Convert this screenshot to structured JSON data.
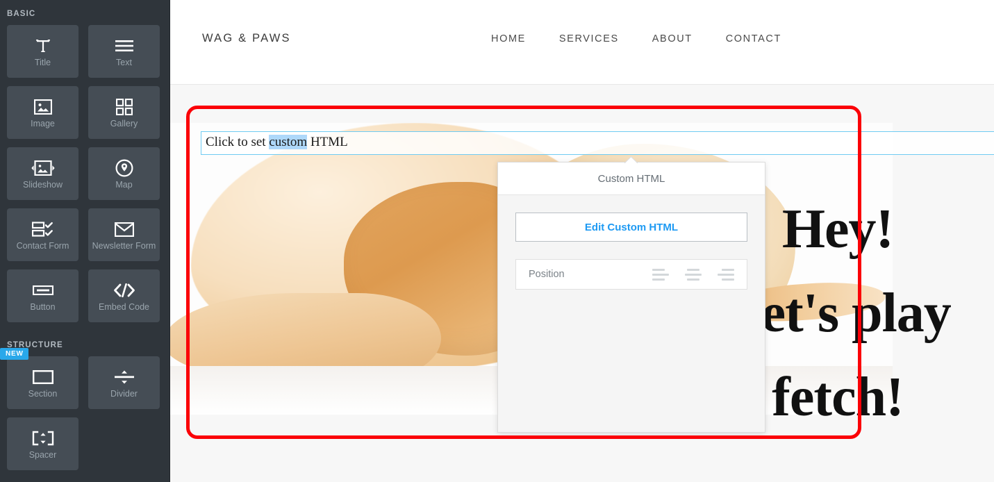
{
  "sidebar": {
    "sections": [
      {
        "label": "BASIC",
        "items": [
          {
            "label": "Title",
            "icon": "title-icon"
          },
          {
            "label": "Text",
            "icon": "text-lines-icon"
          },
          {
            "label": "Image",
            "icon": "image-icon"
          },
          {
            "label": "Gallery",
            "icon": "gallery-grid-icon"
          },
          {
            "label": "Slideshow",
            "icon": "slideshow-icon"
          },
          {
            "label": "Map",
            "icon": "map-pin-icon"
          },
          {
            "label": "Contact Form",
            "icon": "contact-form-icon"
          },
          {
            "label": "Newsletter Form",
            "icon": "envelope-icon"
          },
          {
            "label": "Button",
            "icon": "button-icon"
          },
          {
            "label": "Embed Code",
            "icon": "code-brackets-icon"
          }
        ]
      },
      {
        "label": "STRUCTURE",
        "items": [
          {
            "label": "Section",
            "icon": "rectangle-icon",
            "badge": "NEW"
          },
          {
            "label": "Divider",
            "icon": "divider-icon"
          },
          {
            "label": "Spacer",
            "icon": "spacer-icon"
          }
        ]
      }
    ]
  },
  "site": {
    "logo": "WAG & PAWS",
    "nav": [
      {
        "label": "HOME"
      },
      {
        "label": "SERVICES"
      },
      {
        "label": "ABOUT"
      },
      {
        "label": "CONTACT"
      }
    ],
    "hero": {
      "line1": "Hey!",
      "line2": "Let's play",
      "line3": "fetch!",
      "image_alt": "golden-retriever-puppy-lying-down"
    }
  },
  "custom_html_element": {
    "text_before": "Click to set ",
    "text_selected": "custom",
    "text_after": " HTML"
  },
  "popup": {
    "title": "Custom HTML",
    "edit_button_label": "Edit Custom HTML",
    "position_label": "Position",
    "alignment_options": [
      "align-left",
      "align-center",
      "align-right"
    ]
  },
  "colors": {
    "sidebar_bg": "#2f353b",
    "tile_bg": "#454d55",
    "badge_blue": "#29a8ea",
    "link_blue": "#1e9af3",
    "selection_blue": "#aed8fa",
    "element_outline_blue": "#6fcbf2",
    "annotation_red": "#fb0007"
  }
}
